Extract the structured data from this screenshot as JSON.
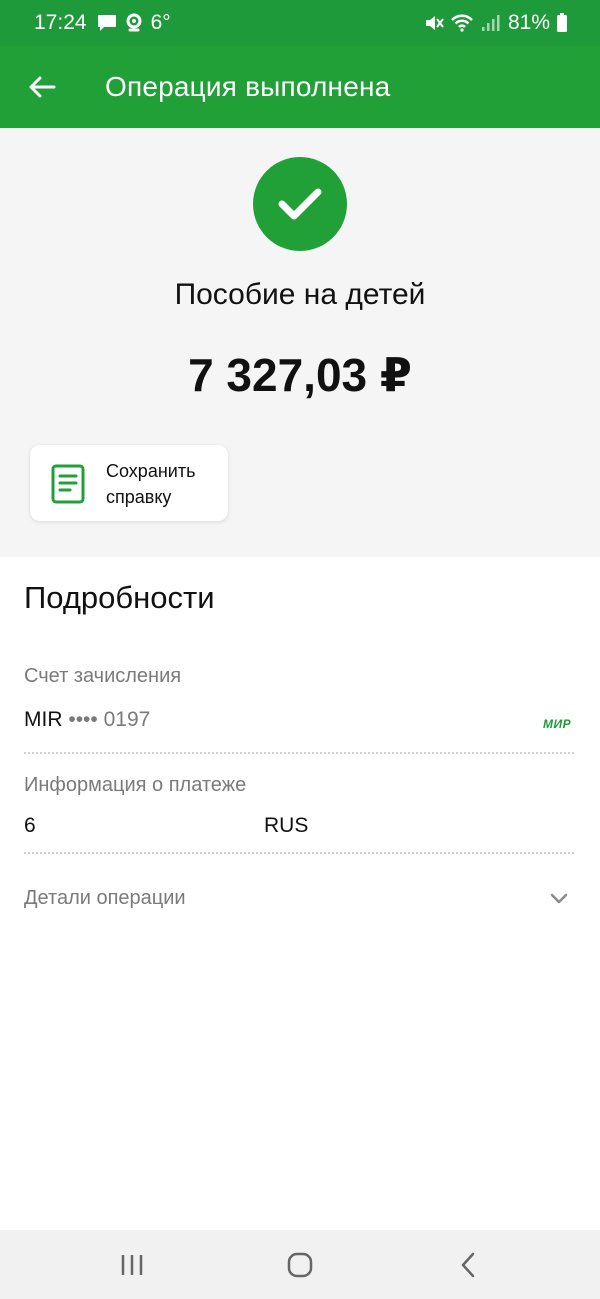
{
  "status_bar": {
    "time": "17:24",
    "temperature": "6°",
    "battery": "81%",
    "icons": [
      "message-icon",
      "location-icon",
      "mute-icon",
      "wifi-icon",
      "signal-icon",
      "battery-icon"
    ]
  },
  "app_bar": {
    "title": "Операция выполнена",
    "back_icon": "arrow-left-icon"
  },
  "summary": {
    "status_icon": "check-icon",
    "title": "Пособие на детей",
    "amount": "7 327,03 ₽",
    "save_button": {
      "icon": "document-icon",
      "label": "Сохранить справку"
    }
  },
  "details": {
    "heading": "Подробности",
    "account": {
      "label": "Счет зачисления",
      "card_type": "MIR",
      "masked": "•••• 0197",
      "logo": "МИР"
    },
    "payment_info": {
      "label": "Информация о платеже",
      "value_left": "6",
      "value_right": "RUS"
    },
    "operation_details": {
      "label": "Детали операции",
      "icon": "chevron-down-icon"
    }
  },
  "nav_bar": {
    "buttons": [
      "recents-icon",
      "home-icon",
      "back-icon"
    ]
  },
  "colors": {
    "brand_green": "#21a038",
    "status_green": "#1f9a3a",
    "background_grey": "#f5f5f5",
    "secondary_text": "#7a7a7a"
  }
}
